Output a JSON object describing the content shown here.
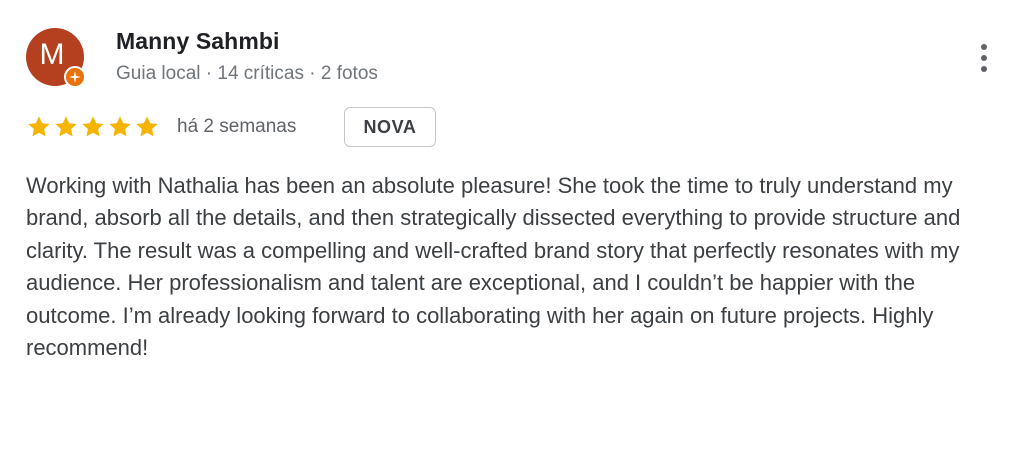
{
  "reviewer": {
    "avatar_initial": "M",
    "avatar_color": "#b5401f",
    "badge_icon": "local-guide-star-icon",
    "badge_color": "#e8710a",
    "name": "Manny Sahmbi",
    "meta": "Guia local · 14 críticas · 2 fotos"
  },
  "menu": {
    "icon": "more-vertical-icon"
  },
  "rating": {
    "stars": 5,
    "max_stars": 5,
    "star_color": "#f4b400",
    "time_ago": "há 2 semanas",
    "badge_label": "NOVA"
  },
  "review": {
    "text": "Working with Nathalia has been an absolute pleasure! She took the time to truly understand my brand, absorb all the details, and then strategically dissected everything to provide structure and clarity. The result was a compelling and well-crafted brand story that perfectly resonates with my audience. Her professionalism and talent are exceptional, and I couldn’t be happier with the outcome. I’m already looking forward to collaborating with her again on future projects. Highly recommend!"
  }
}
